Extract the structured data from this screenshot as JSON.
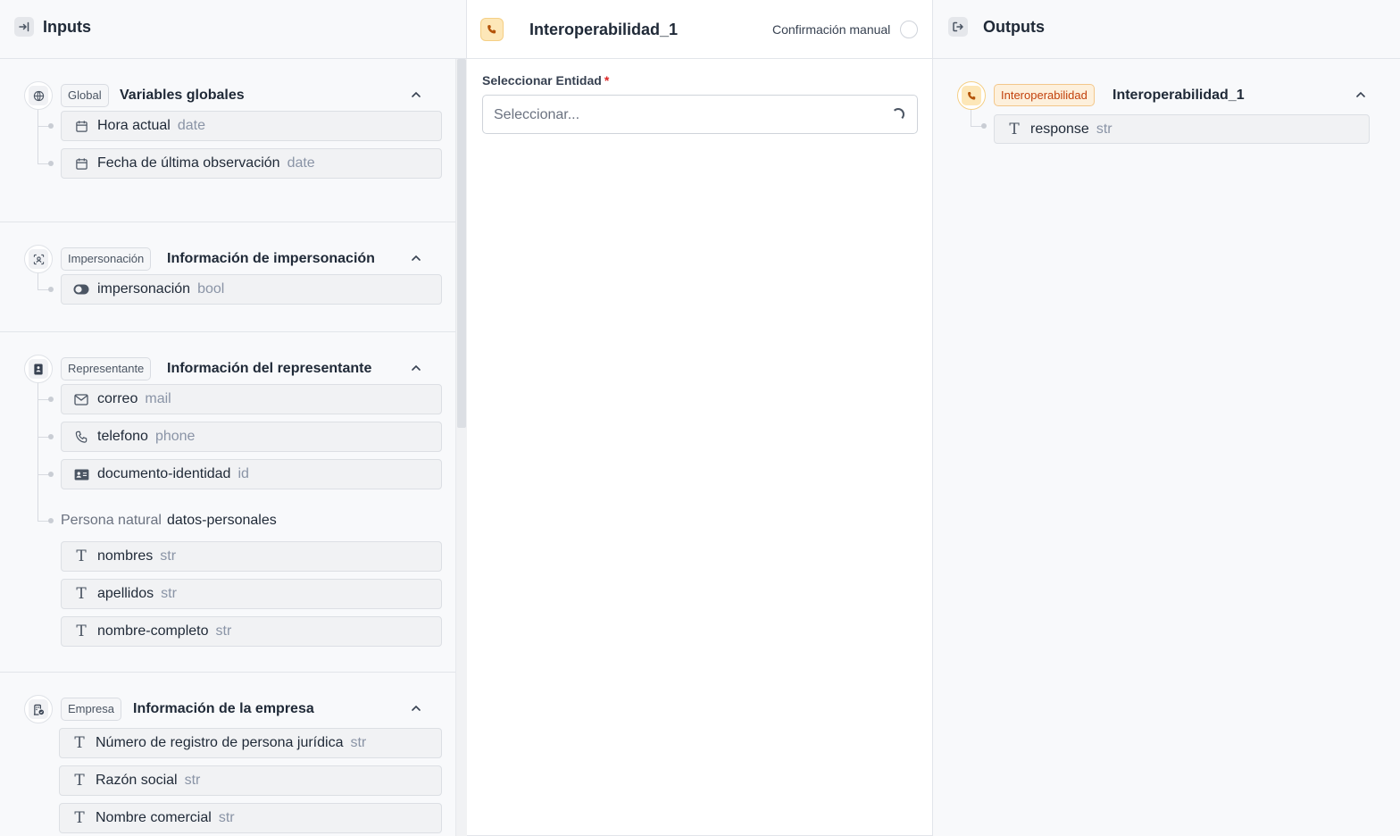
{
  "inputs_panel": {
    "title": "Inputs",
    "sections": [
      {
        "tag": "Global",
        "title": "Variables globales",
        "items": [
          {
            "name": "Hora actual",
            "type": "date",
            "icon": "calendar-icon"
          },
          {
            "name": "Fecha de última observación",
            "type": "date",
            "icon": "calendar-icon"
          }
        ]
      },
      {
        "tag": "Impersonación",
        "title": "Información de impersonación",
        "items": [
          {
            "name": "impersonación",
            "type": "bool",
            "icon": "toggle-icon"
          }
        ]
      },
      {
        "tag": "Representante",
        "title": "Información del representante",
        "items": [
          {
            "name": "correo",
            "type": "mail",
            "icon": "mail-icon"
          },
          {
            "name": "telefono",
            "type": "phone",
            "icon": "phone-icon"
          },
          {
            "name": "documento-identidad",
            "type": "id",
            "icon": "id-card-icon"
          }
        ],
        "subgroup": {
          "tag": "Persona natural",
          "name": "datos-personales",
          "items": [
            {
              "name": "nombres",
              "type": "str",
              "icon": "text-icon"
            },
            {
              "name": "apellidos",
              "type": "str",
              "icon": "text-icon"
            },
            {
              "name": "nombre-completo",
              "type": "str",
              "icon": "text-icon"
            }
          ]
        }
      },
      {
        "tag": "Empresa",
        "title": "Información de la empresa",
        "items": [
          {
            "name": "Número de registro de persona jurídica",
            "type": "str",
            "icon": "text-icon"
          },
          {
            "name": "Razón social",
            "type": "str",
            "icon": "text-icon"
          },
          {
            "name": "Nombre comercial",
            "type": "str",
            "icon": "text-icon"
          }
        ]
      }
    ]
  },
  "center_panel": {
    "title": "Interoperabilidad_1",
    "manual_confirmation_label": "Confirmación manual",
    "field_label": "Seleccionar Entidad",
    "required_mark": "*",
    "select_placeholder": "Seleccionar..."
  },
  "outputs_panel": {
    "title": "Outputs",
    "node": {
      "tag": "Interoperabilidad",
      "title": "Interoperabilidad_1",
      "items": [
        {
          "name": "response",
          "type": "str",
          "icon": "text-icon"
        }
      ]
    }
  },
  "colors": {
    "accent_orange": "#f59e0b",
    "required_red": "#dc2626"
  }
}
